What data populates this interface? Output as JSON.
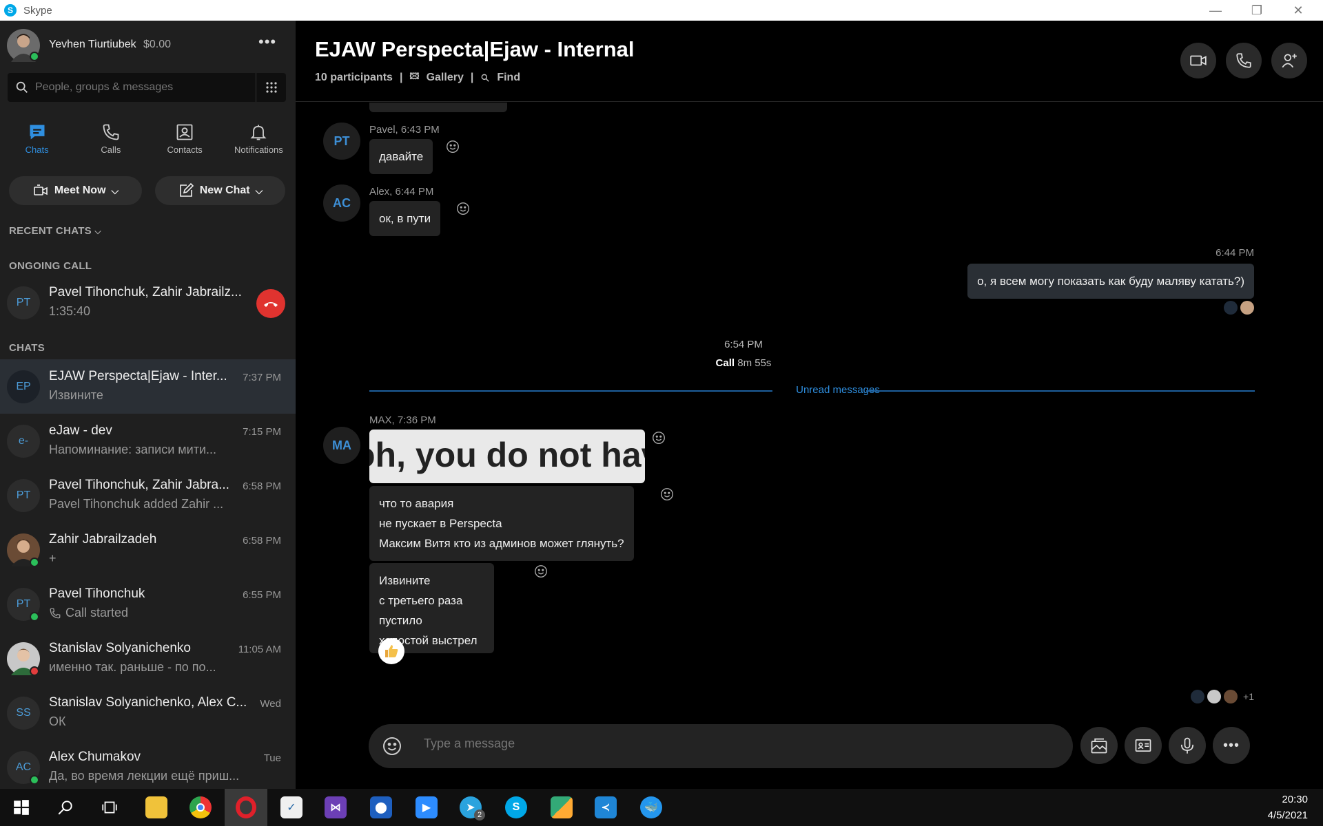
{
  "window": {
    "app_name": "Skype",
    "app_icon": "S"
  },
  "profile": {
    "name": "Yevhen Tiurtiubek",
    "balance": "$0.00"
  },
  "search": {
    "placeholder": "People, groups & messages"
  },
  "nav": {
    "chats": "Chats",
    "calls": "Calls",
    "contacts": "Contacts",
    "notifications": "Notifications"
  },
  "actions": {
    "meet_now": "Meet Now",
    "new_chat": "New Chat"
  },
  "sections": {
    "recent": "RECENT CHATS",
    "ongoing": "ONGOING CALL",
    "chats": "CHATS"
  },
  "ongoing_call": {
    "initials": "PT",
    "name": "Pavel Tihonchuk, Zahir Jabrailz...",
    "duration": "1:35:40"
  },
  "chats": [
    {
      "initials": "EP",
      "name": "EJAW Perspecta|Ejaw - Inter...",
      "preview": "Извините",
      "time": "7:37 PM"
    },
    {
      "initials": "e-",
      "name": "eJaw - dev",
      "preview": "Напоминание:  записи мити...",
      "time": "7:15 PM"
    },
    {
      "initials": "PT",
      "name": "Pavel Tihonchuk, Zahir Jabra...",
      "preview": "Pavel Tihonchuk added Zahir ...",
      "time": "6:58 PM"
    },
    {
      "initials": "",
      "name": "Zahir Jabrailzadeh",
      "preview": "+",
      "time": "6:58 PM"
    },
    {
      "initials": "PT",
      "name": "Pavel Tihonchuk",
      "preview": "Call started",
      "time": "6:55 PM"
    },
    {
      "initials": "",
      "name": "Stanislav Solyanichenko",
      "preview": "именно так. раньше - по по...",
      "time": "11:05 AM"
    },
    {
      "initials": "SS",
      "name": "Stanislav Solyanichenko, Alex C...",
      "preview": "ОК",
      "time": "Wed"
    },
    {
      "initials": "AC",
      "name": "Alex Chumakov",
      "preview": "Да, во время лекции ещё приш...",
      "time": "Tue"
    }
  ],
  "conversation": {
    "title": "EJAW Perspecta|Ejaw - Internal",
    "participants": "10 participants",
    "gallery": "Gallery",
    "find": "Find",
    "messages": [
      {
        "initials": "PT",
        "meta": "Pavel, 6:43 PM",
        "text": "давайте"
      },
      {
        "initials": "AC",
        "meta": "Alex, 6:44 PM",
        "text": "ок, в пути"
      },
      {
        "meta": "6:44 PM",
        "text": "о, я всем могу показать как буду маляву катать?)"
      },
      {
        "initials": "MA",
        "meta": "MAX, 7:36 PM",
        "image_text": "oh, you do not hav",
        "lines": [
          "что то авария",
          "не пускает  в Perspecta",
          "Максим Витя кто из админов может глянуть?"
        ],
        "lines2": [
          "Извините",
          "с третьего раза пустило",
          "холостой выстрел"
        ]
      }
    ],
    "call_time": "6:54 PM",
    "call_label": "Call",
    "call_duration": "8m 55s",
    "unread": "Unread messages",
    "seen_more": "+1"
  },
  "composer": {
    "placeholder": "Type a message"
  },
  "taskbar": {
    "time": "20:30",
    "date": "4/5/2021",
    "telegram_badge": "2"
  },
  "colors": {
    "accent": "#2f8fe0",
    "end_call": "#e0332f",
    "online": "#2bbf5a"
  }
}
